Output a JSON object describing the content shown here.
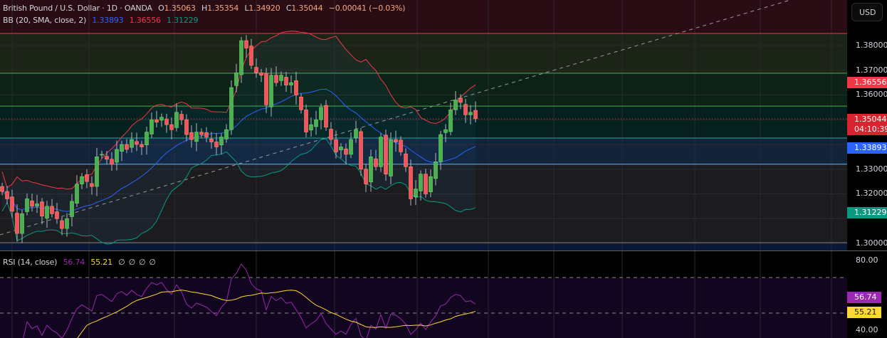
{
  "header": {
    "symbol": "British Pound / U.S. Dollar · 1D · OANDA",
    "open_label": "O",
    "open": "1.35063",
    "high_label": "H",
    "high": "1.35354",
    "low_label": "L",
    "low": "1.34920",
    "close_label": "C",
    "close": "1.35044",
    "change": "−0.00041 (−0.03%)"
  },
  "bb": {
    "label": "BB (20, SMA, close, 2)",
    "basis": "1.33893",
    "upper": "1.36556",
    "lower": "1.31229"
  },
  "rsi": {
    "label": "RSI (14, close)",
    "value": "56.74",
    "ma": "55.21",
    "extras": [
      "∅",
      "∅",
      "∅",
      "∅"
    ]
  },
  "axis": {
    "currency": "USD",
    "price_ticks": [
      "1.38000",
      "1.37000",
      "1.36000",
      "1.33000",
      "1.32000",
      "1.30000"
    ],
    "price_badges": {
      "upper": "1.36556",
      "last": "1.35044",
      "countdown": "04:10:39",
      "basis": "1.33893",
      "lower": "1.31229"
    },
    "rsi_ticks": [
      "80.00",
      "40.00"
    ],
    "rsi_badges": {
      "rsi": "56.74",
      "ma": "55.21"
    }
  },
  "colors": {
    "up": "#4caf50",
    "down": "#f7525f",
    "upper": "#f23645",
    "basis": "#2962ff",
    "lower": "#089981",
    "rsi": "#9c27b0",
    "rsi_ma": "#fdd835"
  },
  "chart_data": {
    "type": "candlestick",
    "levels": [
      1.3849,
      1.3688,
      1.3555,
      1.3426,
      1.332,
      1.3003
    ],
    "closes": [
      1.321,
      1.318,
      1.313,
      1.304,
      1.312,
      1.318,
      1.315,
      1.316,
      1.311,
      1.315,
      1.312,
      1.31,
      1.306,
      1.31,
      1.317,
      1.324,
      1.327,
      1.325,
      1.323,
      1.335,
      1.336,
      1.334,
      1.332,
      1.338,
      1.34,
      1.338,
      1.342,
      1.34,
      1.339,
      1.345,
      1.35,
      1.349,
      1.351,
      1.348,
      1.346,
      1.353,
      1.35,
      1.344,
      1.342,
      1.345,
      1.344,
      1.343,
      1.341,
      1.339,
      1.343,
      1.346,
      1.363,
      1.369,
      1.382,
      1.379,
      1.372,
      1.369,
      1.368,
      1.356,
      1.368,
      1.365,
      1.368,
      1.364,
      1.365,
      1.36,
      1.354,
      1.345,
      1.348,
      1.35,
      1.355,
      1.347,
      1.342,
      1.337,
      1.339,
      1.336,
      1.342,
      1.346,
      1.33,
      1.324,
      1.335,
      1.331,
      1.343,
      1.328,
      1.342,
      1.341,
      1.337,
      1.331,
      1.318,
      1.322,
      1.328,
      1.32,
      1.327,
      1.333,
      1.344,
      1.346,
      1.354,
      1.358,
      1.357,
      1.352,
      1.353,
      1.3504
    ]
  }
}
